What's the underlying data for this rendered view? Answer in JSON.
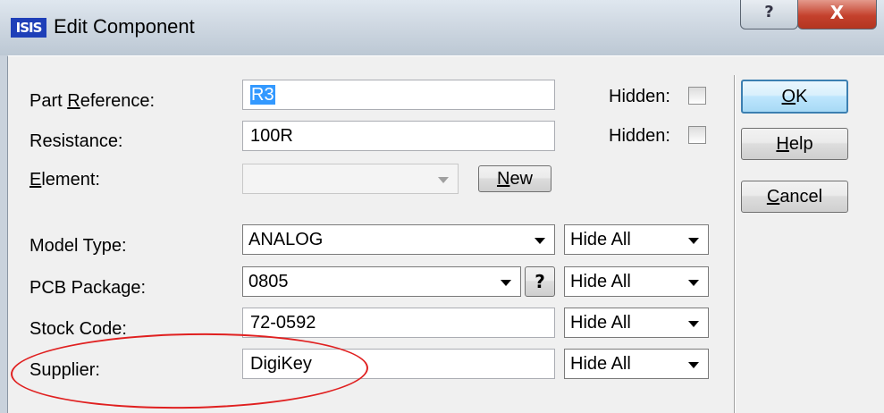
{
  "titlebar": {
    "icon_text": "ISIS",
    "title": "Edit Component",
    "help_glyph": "?",
    "close_glyph": "X"
  },
  "fields": {
    "part_reference": {
      "label_pre": "Part ",
      "label_key": "R",
      "label_post": "eference:",
      "value": "R3",
      "hidden_label": "Hidden:"
    },
    "resistance": {
      "label": "Resistance:",
      "value": "100R",
      "hidden_label": "Hidden:"
    },
    "element": {
      "label_key": "E",
      "label_post": "lement:",
      "value": "",
      "new_key": "N",
      "new_post": "ew"
    },
    "model_type": {
      "label": "Model Type:",
      "value": "ANALOG",
      "visibility": "Hide All"
    },
    "pcb_package": {
      "label": "PCB Package:",
      "value": "0805",
      "help": "?",
      "visibility": "Hide All"
    },
    "stock_code": {
      "label": "Stock Code:",
      "value": "72-0592",
      "visibility": "Hide All"
    },
    "supplier": {
      "label": "Supplier:",
      "value": "DigiKey",
      "visibility": "Hide All"
    }
  },
  "buttons": {
    "ok_key": "O",
    "ok_post": "K",
    "help_key": "H",
    "help_post": "elp",
    "cancel_key": "C",
    "cancel_post": "ancel"
  },
  "colors": {
    "annotation_oval": "#e02020",
    "selection": "#3399ff",
    "close_button": "#c4412d"
  }
}
